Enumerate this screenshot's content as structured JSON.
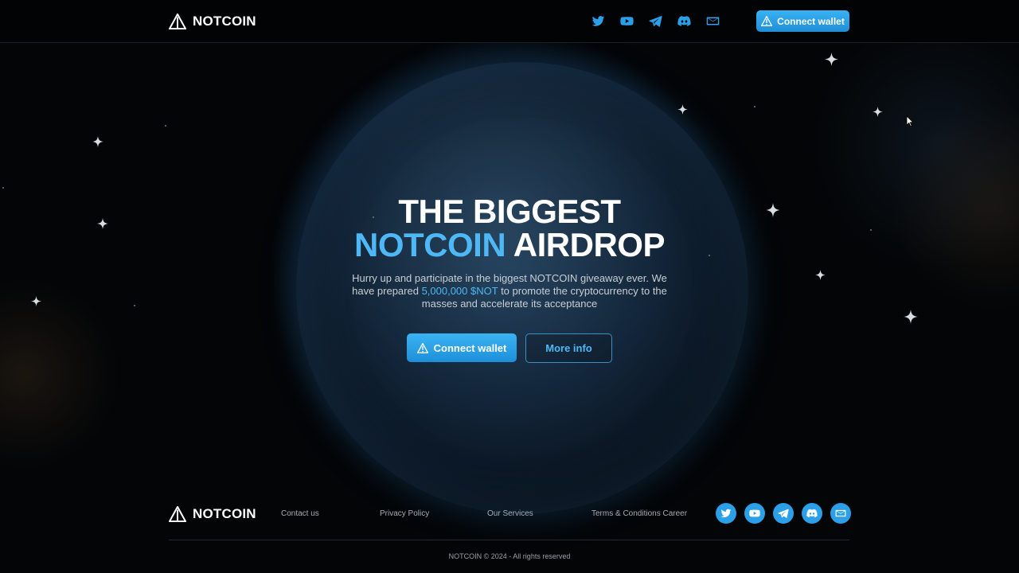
{
  "brand": {
    "name": "NOTCOIN"
  },
  "header": {
    "social_icons": [
      "twitter-icon",
      "youtube-icon",
      "telegram-icon",
      "discord-icon",
      "mail-icon"
    ],
    "connect_label": "Connect wallet"
  },
  "hero": {
    "title_line1": "THE BIGGEST",
    "title_accent": "NOTCOIN",
    "title_rest": "AIRDROP",
    "desc_part1": "Hurry up and participate in the biggest NOTCOIN giveaway ever. We have prepared ",
    "desc_accent": "5,000,000 $NOT",
    "desc_part2": " to promote the cryptocurrency to the masses and accelerate its acceptance",
    "connect_label": "Connect wallet",
    "more_label": "More info"
  },
  "footer": {
    "links": [
      "Contact us",
      "Privacy Policy",
      "Our Services",
      "Terms & Conditions Career"
    ],
    "social_icons": [
      "twitter-icon",
      "youtube-icon",
      "telegram-icon",
      "discord-icon",
      "mail-icon"
    ],
    "copyright": "NOTCOIN © 2024 - All rights reserved"
  },
  "colors": {
    "accent": "#4db8f5",
    "button": "#2b9fe8",
    "background": "#030507"
  }
}
